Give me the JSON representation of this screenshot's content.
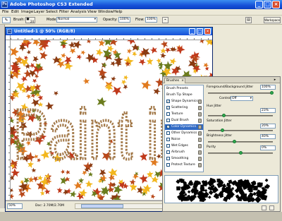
{
  "app": {
    "title": "Adobe Photoshop CS3 Extended",
    "icon_text": "Ps"
  },
  "window_controls": {
    "minimize": "_",
    "maximize": "□",
    "close": "×"
  },
  "menu": [
    "File",
    "Edit",
    "Image",
    "Layer",
    "Select",
    "Filter",
    "Analysis",
    "View",
    "Window",
    "Help"
  ],
  "options_bar": {
    "tool_preset_icon": "brush-icon",
    "brush_label": "Brush:",
    "brush_size": "24",
    "mode_label": "Mode:",
    "mode_value": "Normal",
    "opacity_label": "Opacity:",
    "opacity_value": "100%",
    "flow_label": "Flow:",
    "flow_value": "100%",
    "workspace_label": "Workspace"
  },
  "document": {
    "title": "Untitled-1 @ 50% (RGB/8)",
    "canvas_text": "Paint in colo",
    "zoom": "50%",
    "doc_info": "Doc: 2.70M/2.70M"
  },
  "brushes_panel": {
    "tab_label": "Brushes",
    "menu_glyph": "▸",
    "list": [
      {
        "label": "Brush Presets",
        "checkbox": false,
        "checked": false,
        "selected": false,
        "lock": false
      },
      {
        "label": "Brush Tip Shape",
        "checkbox": false,
        "checked": false,
        "selected": false,
        "lock": false
      },
      {
        "label": "Shape Dynamics",
        "checkbox": true,
        "checked": true,
        "selected": false,
        "lock": true
      },
      {
        "label": "Scattering",
        "checkbox": true,
        "checked": true,
        "selected": false,
        "lock": true
      },
      {
        "label": "Texture",
        "checkbox": true,
        "checked": false,
        "selected": false,
        "lock": true
      },
      {
        "label": "Dual Brush",
        "checkbox": true,
        "checked": false,
        "selected": false,
        "lock": true
      },
      {
        "label": "Color Dynamics",
        "checkbox": true,
        "checked": true,
        "selected": true,
        "lock": true
      },
      {
        "label": "Other Dynamics",
        "checkbox": true,
        "checked": false,
        "selected": false,
        "lock": true
      },
      {
        "label": "Noise",
        "checkbox": true,
        "checked": false,
        "selected": false,
        "lock": true
      },
      {
        "label": "Wet Edges",
        "checkbox": true,
        "checked": false,
        "selected": false,
        "lock": true
      },
      {
        "label": "Airbrush",
        "checkbox": true,
        "checked": false,
        "selected": false,
        "lock": true
      },
      {
        "label": "Smoothing",
        "checkbox": true,
        "checked": false,
        "selected": false,
        "lock": true
      },
      {
        "label": "Protect Texture",
        "checkbox": true,
        "checked": false,
        "selected": false,
        "lock": true
      }
    ],
    "settings": {
      "fg_bg_jitter_label": "Foreground/Background Jitter",
      "fg_bg_jitter_value": "100%",
      "fg_bg_jitter_level": 1.0,
      "control_label": "Control:",
      "control_value": "Off",
      "hue_jitter_label": "Hue Jitter",
      "hue_jitter_value": "23%",
      "hue_jitter_level": 0.23,
      "saturation_jitter_label": "Saturation Jitter",
      "saturation_jitter_value": "20%",
      "saturation_jitter_level": 0.2,
      "brightness_jitter_label": "Brightness Jitter",
      "brightness_jitter_value": "40%",
      "brightness_jitter_level": 0.4,
      "purity_label": "Purity",
      "purity_value": "0%",
      "purity_level": 0.5
    }
  },
  "colors": {
    "title_bar": "#1650d8",
    "selection": "#316ac5",
    "leaf_colors": [
      "#c0391b",
      "#e07a1f",
      "#f2b71f",
      "#8a3b12",
      "#6b7c1d",
      "#b8481a"
    ],
    "text_outline": "#a27848"
  }
}
